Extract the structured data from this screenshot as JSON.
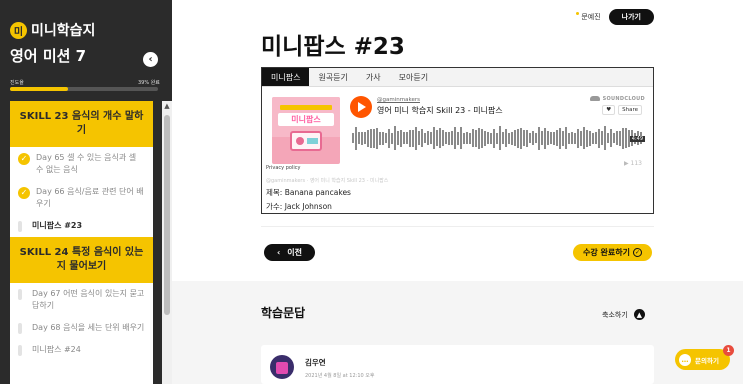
{
  "sidebar": {
    "logo_badge": "미",
    "logo_text": "미니학습지",
    "mission_title": "영어 미션 7",
    "back_icon": "chevron-left-icon",
    "progress_label": "진도율",
    "progress_pct_text": "39% 완료",
    "progress_value": 0.39,
    "skills": [
      {
        "title": "SKILL 23 음식의 개수 말하기",
        "lessons": [
          {
            "label": "Day 65 셀 수 있는 음식과 셀 수 없는 음식",
            "status": "done"
          },
          {
            "label": "Day 66 음식/음료 관련 단어 배우기",
            "status": "done"
          },
          {
            "label": "미니팝스 #23",
            "status": "current"
          }
        ]
      },
      {
        "title": "SKILL 24 특정 음식이 있는지 물어보기",
        "lessons": [
          {
            "label": "Day 67 어떤 음식이 있는지 묻고 답하기",
            "status": "todo"
          },
          {
            "label": "Day 68 음식을 세는 단위 배우기",
            "status": "todo"
          },
          {
            "label": "미니팝스 #24",
            "status": "todo"
          }
        ]
      }
    ]
  },
  "header": {
    "link_label": "문예진",
    "exit_label": "나가기"
  },
  "page_title": "미니팝스 #23",
  "tabs": [
    {
      "label": "미니팝스",
      "active": true
    },
    {
      "label": "원곡듣기",
      "active": false
    },
    {
      "label": "가사",
      "active": false
    },
    {
      "label": "모아듣기",
      "active": false
    }
  ],
  "player": {
    "art_title": "미니팝스",
    "uploader": "@gaminmakers",
    "track": "영어 미니 학습지 Skill 23 - 미니팝스",
    "brand": "SOUNDCLOUD",
    "like_label": "♥",
    "share_label": "Share",
    "duration": "4:49",
    "plays": "▶ 113",
    "privacy": "Privacy policy",
    "faded_line": "@gaminmakers · 영어 미니 학습지 Skill 23 - 미니팝스"
  },
  "song": {
    "title_line": "제목: Banana pancakes",
    "artist_line": "가수: Jack Johnson"
  },
  "nav": {
    "prev_label": "이전",
    "complete_label": "수강 완료하기"
  },
  "qa": {
    "title": "학습문답",
    "collapse_label": "축소하기",
    "comment": {
      "name": "김우연",
      "date": "2021년 4월 8일 at 12:10 오후"
    }
  },
  "chat": {
    "label": "문의하기",
    "badge": "1"
  },
  "colors": {
    "accent": "#f5c400",
    "sidebar_bg": "#2b2b2b",
    "soundcloud": "#ff5500"
  }
}
